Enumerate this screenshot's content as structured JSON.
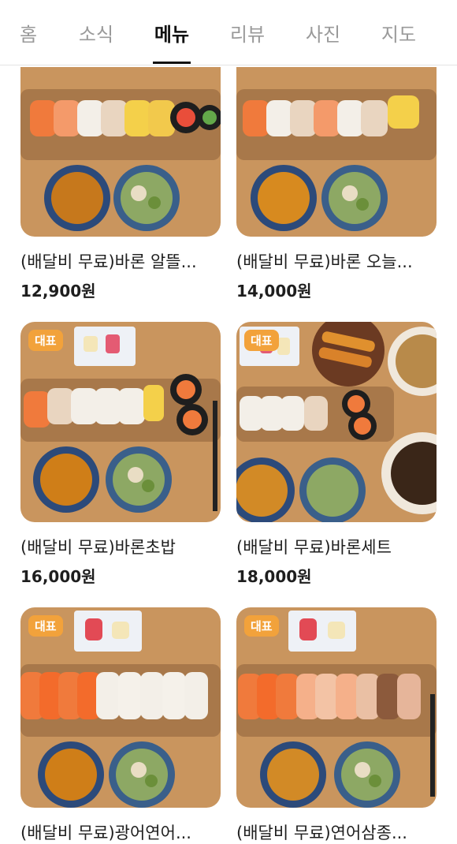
{
  "tabs": [
    "홈",
    "소식",
    "메뉴",
    "리뷰",
    "사진",
    "지도"
  ],
  "active_tab_index": 2,
  "badge_label": "대표",
  "menu_items": [
    {
      "title": "(배달비 무료)바론 알뜰...",
      "price": "12,900원",
      "badge": false
    },
    {
      "title": "(배달비 무료)바론 오늘...",
      "price": "14,000원",
      "badge": false
    },
    {
      "title": "(배달비 무료)바론초밥",
      "price": "16,000원",
      "badge": true
    },
    {
      "title": "(배달비 무료)바론세트",
      "price": "18,000원",
      "badge": true
    },
    {
      "title": "(배달비 무료)광어연어...",
      "price": "",
      "badge": true
    },
    {
      "title": "(배달비 무료)연어삼종...",
      "price": "",
      "badge": true
    }
  ],
  "colors": {
    "wood": "#c9955e",
    "board": "#a8784a",
    "salmon": "#f07a3c",
    "badge": "#f2a23b",
    "soup": "#c6781c"
  }
}
